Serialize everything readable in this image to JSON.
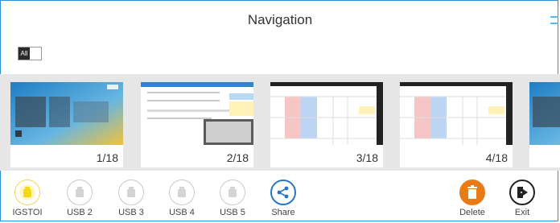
{
  "header": {
    "title": "Navigation"
  },
  "toggle": {
    "label": "All"
  },
  "thumbnails": [
    {
      "page": "1/18"
    },
    {
      "page": "2/18"
    },
    {
      "page": "3/18"
    },
    {
      "page": "4/18"
    }
  ],
  "bottom_bar": {
    "storage": [
      {
        "label": "IGSTOI",
        "active": true
      },
      {
        "label": "USB 2",
        "active": false
      },
      {
        "label": "USB 3",
        "active": false
      },
      {
        "label": "USB 4",
        "active": false
      },
      {
        "label": "USB 5",
        "active": false
      }
    ],
    "share": {
      "label": "Share",
      "icon": "share-icon"
    },
    "delete": {
      "label": "Delete",
      "icon": "trash-icon"
    },
    "exit": {
      "label": "Exit",
      "icon": "exit-icon"
    }
  },
  "colors": {
    "frame": "#2e8fd6",
    "accent_yellow": "#f5d916",
    "share": "#2a76c6",
    "delete": "#e97a18",
    "exit": "#222222"
  }
}
